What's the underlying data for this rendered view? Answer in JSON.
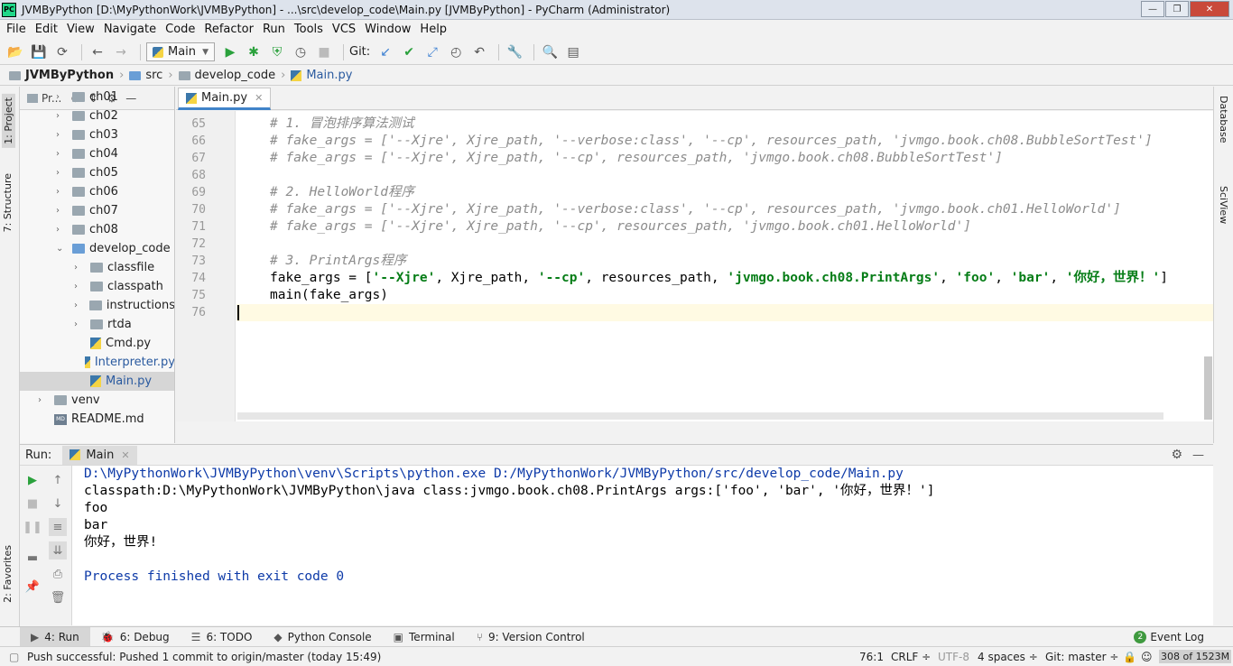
{
  "window": {
    "title": "JVMByPython [D:\\MyPythonWork\\JVMByPython] - ...\\src\\develop_code\\Main.py [JVMByPython] - PyCharm (Administrator)",
    "app_badge": "PC",
    "min": "—",
    "max": "❐",
    "close": "✕"
  },
  "menu": [
    "File",
    "Edit",
    "View",
    "Navigate",
    "Code",
    "Refactor",
    "Run",
    "Tools",
    "VCS",
    "Window",
    "Help"
  ],
  "toolbar": {
    "run_config": "Main",
    "git_label": "Git:"
  },
  "breadcrumb": [
    "JVMByPython",
    "src",
    "develop_code",
    "Main.py"
  ],
  "left_tabs": {
    "project": "1: Project",
    "structure": "7: Structure",
    "favorites": "2: Favorites"
  },
  "right_tabs": {
    "database": "Database",
    "sciview": "SciView"
  },
  "project_panel": {
    "header": "Pr...",
    "tree": [
      {
        "label": "ch01",
        "type": "folder",
        "level": 0,
        "arrow": "›"
      },
      {
        "label": "ch02",
        "type": "folder",
        "level": 0,
        "arrow": "›"
      },
      {
        "label": "ch03",
        "type": "folder",
        "level": 0,
        "arrow": "›"
      },
      {
        "label": "ch04",
        "type": "folder",
        "level": 0,
        "arrow": "›"
      },
      {
        "label": "ch05",
        "type": "folder",
        "level": 0,
        "arrow": "›"
      },
      {
        "label": "ch06",
        "type": "folder",
        "level": 0,
        "arrow": "›"
      },
      {
        "label": "ch07",
        "type": "folder",
        "level": 0,
        "arrow": "›"
      },
      {
        "label": "ch08",
        "type": "folder",
        "level": 0,
        "arrow": "›"
      },
      {
        "label": "develop_code",
        "type": "folder-blue",
        "level": 0,
        "arrow": "⌄"
      },
      {
        "label": "classfile",
        "type": "folder",
        "level": 1,
        "arrow": "›"
      },
      {
        "label": "classpath",
        "type": "folder",
        "level": 1,
        "arrow": "›"
      },
      {
        "label": "instructions",
        "type": "folder",
        "level": 1,
        "arrow": "›"
      },
      {
        "label": "rtda",
        "type": "folder",
        "level": 1,
        "arrow": "›"
      },
      {
        "label": "Cmd.py",
        "type": "py",
        "level": 1,
        "arrow": ""
      },
      {
        "label": "Interpreter.py",
        "type": "py-blue",
        "level": 1,
        "arrow": ""
      },
      {
        "label": "Main.py",
        "type": "py-blue",
        "level": 1,
        "arrow": "",
        "selected": true
      },
      {
        "label": "venv",
        "type": "folder",
        "level": -1,
        "arrow": "›"
      },
      {
        "label": "README.md",
        "type": "md",
        "level": -1,
        "arrow": ""
      }
    ]
  },
  "editor": {
    "tab": "Main.py",
    "lines": [
      {
        "n": "65",
        "html": "<span class='cmt'># 1. 冒泡排序算法测试</span>"
      },
      {
        "n": "66",
        "html": "<span class='cmt'># fake_args = ['--Xjre', Xjre_path, '--verbose:class', '--cp', resources_path, 'jvmgo.book.ch08.BubbleSortTest']</span>"
      },
      {
        "n": "67",
        "html": "<span class='cmt'># fake_args = ['--Xjre', Xjre_path, '--cp', resources_path, 'jvmgo.book.ch08.BubbleSortTest']</span>"
      },
      {
        "n": "68",
        "html": ""
      },
      {
        "n": "69",
        "html": "<span class='cmt'># 2. HelloWorld程序</span>"
      },
      {
        "n": "70",
        "html": "<span class='cmt'># fake_args = ['--Xjre', Xjre_path, '--verbose:class', '--cp', resources_path, 'jvmgo.book.ch01.HelloWorld']</span>"
      },
      {
        "n": "71",
        "html": "<span class='cmt'># fake_args = ['--Xjre', Xjre_path, '--cp', resources_path, 'jvmgo.book.ch01.HelloWorld']</span>"
      },
      {
        "n": "72",
        "html": ""
      },
      {
        "n": "73",
        "html": "<span class='cmt'># 3. PrintArgs程序</span>"
      },
      {
        "n": "74",
        "html": "fake_args = [<span class='str'>'--Xjre'</span>, Xjre_path, <span class='str'>'--cp'</span>, resources_path, <span class='str'>'jvmgo.book.ch08.PrintArgs'</span>, <span class='str'>'foo'</span>, <span class='str'>'bar'</span>, <span class='str'>'你好，世界！'</span>]"
      },
      {
        "n": "75",
        "html": "main(fake_args)"
      },
      {
        "n": "76",
        "html": ""
      }
    ]
  },
  "run": {
    "label": "Run:",
    "tab": "Main",
    "output": [
      {
        "text": "D:\\MyPythonWork\\JVMByPython\\venv\\Scripts\\python.exe D:/MyPythonWork/JVMByPython/src/develop_code/Main.py",
        "color": "#0d3aa8"
      },
      {
        "text": "classpath:D:\\MyPythonWork\\JVMByPython\\java class:jvmgo.book.ch08.PrintArgs args:['foo', 'bar', '你好，世界！']",
        "color": "#000000"
      },
      {
        "text": "foo",
        "color": "#000000"
      },
      {
        "text": "bar",
        "color": "#000000"
      },
      {
        "text": "你好，世界!",
        "color": "#000000"
      },
      {
        "text": "",
        "color": "#000000"
      },
      {
        "text": "Process finished with exit code 0",
        "color": "#0d3aa8"
      }
    ]
  },
  "bottom_tabs": [
    {
      "label": "4: Run",
      "icon": "▶",
      "active": true
    },
    {
      "label": "6: Debug",
      "icon": "🐞",
      "active": false
    },
    {
      "label": "6: TODO",
      "icon": "☰",
      "active": false
    },
    {
      "label": "Python Console",
      "icon": "◆",
      "active": false
    },
    {
      "label": "Terminal",
      "icon": "▣",
      "active": false
    },
    {
      "label": "9: Version Control",
      "icon": "⑂",
      "active": false
    }
  ],
  "event_log": {
    "label": "Event Log",
    "count": "2"
  },
  "status": {
    "message": "Push successful: Pushed 1 commit to origin/master (today 15:49)",
    "position": "76:1",
    "line_sep": "CRLF ÷",
    "encoding": "UTF-8",
    "indent": "4 spaces ÷",
    "branch": "Git: master ÷",
    "memory": "308 of 1523M"
  },
  "colors": {
    "accent": "#4083c9",
    "comment": "#8c8c8c",
    "string": "#067d17",
    "console_link": "#0d3aa8",
    "current_line": "#fffae3"
  }
}
